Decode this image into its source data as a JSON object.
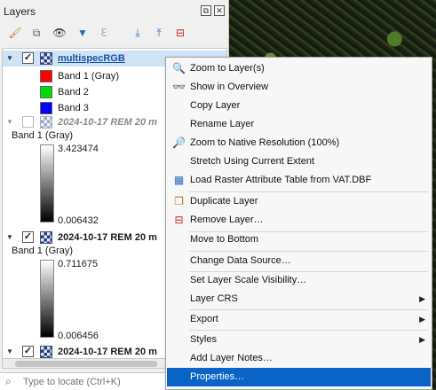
{
  "panel": {
    "title": "Layers",
    "float_glyph": "⧉",
    "close_glyph": "✕",
    "locator_placeholder": "Type to locate (Ctrl+K)"
  },
  "layers": {
    "multispec": {
      "name": "multispecRGB",
      "bands": [
        {
          "label": "Band 1 (Gray)",
          "color": "#ff0000"
        },
        {
          "label": "Band 2",
          "color": "#00dd00"
        },
        {
          "label": "Band 3",
          "color": "#0000ff"
        }
      ]
    },
    "rem1": {
      "name": "2024-10-17 REM 20 m",
      "band": "Band 1 (Gray)",
      "max": "3.423474",
      "min": "0.006432"
    },
    "rem2": {
      "name": "2024-10-17 REM 20 m",
      "band": "Band 1 (Gray)",
      "max": "0.711675",
      "min": "0.006456"
    },
    "rem3": {
      "name": "2024-10-17 REM 20 m"
    }
  },
  "menu": {
    "zoom_to_layer": "Zoom to Layer(s)",
    "show_in_overview": "Show in Overview",
    "copy_layer": "Copy Layer",
    "rename_layer": "Rename Layer",
    "zoom_native": "Zoom to Native Resolution (100%)",
    "stretch": "Stretch Using Current Extent",
    "load_rat": "Load Raster Attribute Table from VAT.DBF",
    "duplicate": "Duplicate Layer",
    "remove": "Remove Layer…",
    "move_bottom": "Move to Bottom",
    "change_source": "Change Data Source…",
    "scale_vis": "Set Layer Scale Visibility…",
    "layer_crs": "Layer CRS",
    "export": "Export",
    "styles": "Styles",
    "notes": "Add Layer Notes…",
    "properties": "Properties…"
  },
  "colors": {
    "selected": "#0a64c8"
  }
}
